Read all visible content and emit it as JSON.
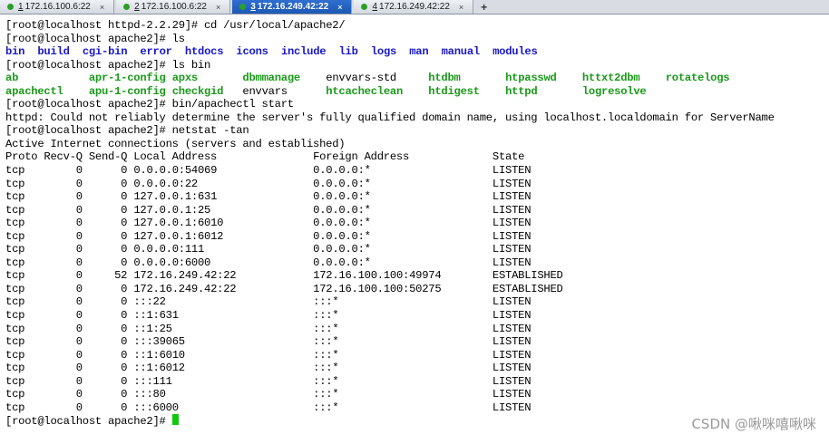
{
  "tabs": [
    {
      "number": "1",
      "label": "172.16.100.6:22",
      "active": false
    },
    {
      "number": "2",
      "label": "172.16.100.6:22",
      "active": false
    },
    {
      "number": "3",
      "label": "172.16.249.42:22",
      "active": true
    },
    {
      "number": "4",
      "label": "172.16.249.42:22",
      "active": false
    }
  ],
  "tab_close_glyph": "×",
  "tab_add_glyph": "+",
  "terminal": {
    "prompt1": "[root@localhost httpd-2.2.29]# ",
    "cmd1": "cd /usr/local/apache2/",
    "prompt2": "[root@localhost apache2]# ",
    "cmd2": "ls",
    "ls_dirs": [
      "bin",
      "build",
      "cgi-bin",
      "error",
      "htdocs",
      "icons",
      "include",
      "lib",
      "logs",
      "man",
      "manual",
      "modules"
    ],
    "prompt3": "[root@localhost apache2]# ",
    "cmd3": "ls bin",
    "bin_row1": [
      {
        "name": "ab",
        "exec": true
      },
      {
        "name": "apr-1-config",
        "exec": true
      },
      {
        "name": "apxs",
        "exec": true
      },
      {
        "name": "dbmmanage",
        "exec": true
      },
      {
        "name": "envvars-std",
        "exec": false
      },
      {
        "name": "htdbm",
        "exec": true
      },
      {
        "name": "htpasswd",
        "exec": true
      },
      {
        "name": "httxt2dbm",
        "exec": true
      },
      {
        "name": "rotatelogs",
        "exec": true
      }
    ],
    "bin_row2": [
      {
        "name": "apachectl",
        "exec": true
      },
      {
        "name": "apu-1-config",
        "exec": true
      },
      {
        "name": "checkgid",
        "exec": true
      },
      {
        "name": "envvars",
        "exec": false
      },
      {
        "name": "htcacheclean",
        "exec": true
      },
      {
        "name": "htdigest",
        "exec": true
      },
      {
        "name": "httpd",
        "exec": true
      },
      {
        "name": "logresolve",
        "exec": true
      }
    ],
    "prompt4": "[root@localhost apache2]# ",
    "cmd4": "bin/apachectl start",
    "httpd_msg": "httpd: Could not reliably determine the server's fully qualified domain name, using localhost.localdomain for ServerName",
    "prompt5": "[root@localhost apache2]# ",
    "cmd5": "netstat -tan",
    "netstat_title": "Active Internet connections (servers and established)",
    "netstat_header": {
      "proto": "Proto",
      "recvq": "Recv-Q",
      "sendq": "Send-Q",
      "local": "Local Address",
      "foreign": "Foreign Address",
      "state": "State"
    },
    "netstat_rows": [
      {
        "proto": "tcp",
        "recvq": "0",
        "sendq": "0",
        "local": "0.0.0.0:54069",
        "foreign": "0.0.0.0:*",
        "state": "LISTEN"
      },
      {
        "proto": "tcp",
        "recvq": "0",
        "sendq": "0",
        "local": "0.0.0.0:22",
        "foreign": "0.0.0.0:*",
        "state": "LISTEN"
      },
      {
        "proto": "tcp",
        "recvq": "0",
        "sendq": "0",
        "local": "127.0.0.1:631",
        "foreign": "0.0.0.0:*",
        "state": "LISTEN"
      },
      {
        "proto": "tcp",
        "recvq": "0",
        "sendq": "0",
        "local": "127.0.0.1:25",
        "foreign": "0.0.0.0:*",
        "state": "LISTEN"
      },
      {
        "proto": "tcp",
        "recvq": "0",
        "sendq": "0",
        "local": "127.0.0.1:6010",
        "foreign": "0.0.0.0:*",
        "state": "LISTEN"
      },
      {
        "proto": "tcp",
        "recvq": "0",
        "sendq": "0",
        "local": "127.0.0.1:6012",
        "foreign": "0.0.0.0:*",
        "state": "LISTEN"
      },
      {
        "proto": "tcp",
        "recvq": "0",
        "sendq": "0",
        "local": "0.0.0.0:111",
        "foreign": "0.0.0.0:*",
        "state": "LISTEN"
      },
      {
        "proto": "tcp",
        "recvq": "0",
        "sendq": "0",
        "local": "0.0.0.0:6000",
        "foreign": "0.0.0.0:*",
        "state": "LISTEN"
      },
      {
        "proto": "tcp",
        "recvq": "0",
        "sendq": "52",
        "local": "172.16.249.42:22",
        "foreign": "172.16.100.100:49974",
        "state": "ESTABLISHED"
      },
      {
        "proto": "tcp",
        "recvq": "0",
        "sendq": "0",
        "local": "172.16.249.42:22",
        "foreign": "172.16.100.100:50275",
        "state": "ESTABLISHED"
      },
      {
        "proto": "tcp",
        "recvq": "0",
        "sendq": "0",
        "local": ":::22",
        "foreign": ":::*",
        "state": "LISTEN"
      },
      {
        "proto": "tcp",
        "recvq": "0",
        "sendq": "0",
        "local": "::1:631",
        "foreign": ":::*",
        "state": "LISTEN"
      },
      {
        "proto": "tcp",
        "recvq": "0",
        "sendq": "0",
        "local": "::1:25",
        "foreign": ":::*",
        "state": "LISTEN"
      },
      {
        "proto": "tcp",
        "recvq": "0",
        "sendq": "0",
        "local": ":::39065",
        "foreign": ":::*",
        "state": "LISTEN"
      },
      {
        "proto": "tcp",
        "recvq": "0",
        "sendq": "0",
        "local": "::1:6010",
        "foreign": ":::*",
        "state": "LISTEN"
      },
      {
        "proto": "tcp",
        "recvq": "0",
        "sendq": "0",
        "local": "::1:6012",
        "foreign": ":::*",
        "state": "LISTEN"
      },
      {
        "proto": "tcp",
        "recvq": "0",
        "sendq": "0",
        "local": ":::111",
        "foreign": ":::*",
        "state": "LISTEN"
      },
      {
        "proto": "tcp",
        "recvq": "0",
        "sendq": "0",
        "local": ":::80",
        "foreign": ":::*",
        "state": "LISTEN"
      },
      {
        "proto": "tcp",
        "recvq": "0",
        "sendq": "0",
        "local": ":::6000",
        "foreign": ":::*",
        "state": "LISTEN"
      }
    ],
    "prompt6": "[root@localhost apache2]# "
  },
  "watermark": "CSDN @啾咪嘻啾咪",
  "colors": {
    "dir": "#1818c8",
    "exec": "#1a9a1a",
    "cursor": "#11c611",
    "active_tab": "#1d58b4"
  }
}
